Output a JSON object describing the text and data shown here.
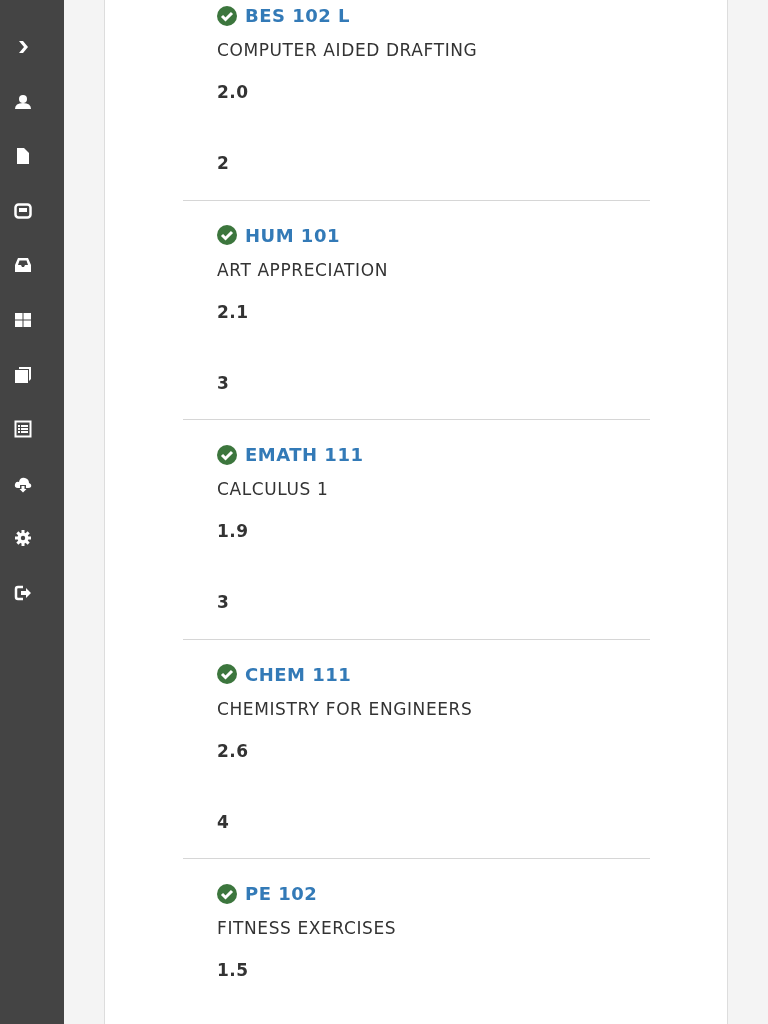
{
  "courses": [
    {
      "code": "BES 102 L",
      "title": "COMPUTER AIDED DRAFTING",
      "grade": "2.0",
      "units": "2"
    },
    {
      "code": "HUM 101",
      "title": "ART APPRECIATION",
      "grade": "2.1",
      "units": "3"
    },
    {
      "code": "EMATH 111",
      "title": "CALCULUS 1",
      "grade": "1.9",
      "units": "3"
    },
    {
      "code": "CHEM 111",
      "title": "CHEMISTRY FOR ENGINEERS",
      "grade": "2.6",
      "units": "4"
    },
    {
      "code": "PE 102",
      "title": "FITNESS EXERCISES",
      "grade": "1.5"
    }
  ]
}
